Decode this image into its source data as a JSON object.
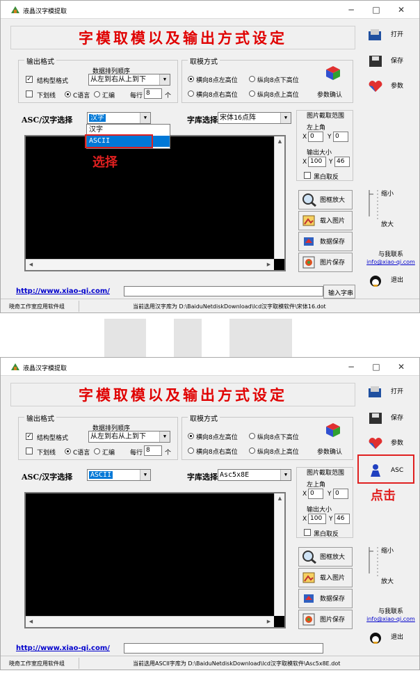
{
  "window": {
    "title": "液晶汉字模提取",
    "minimize": "−",
    "maximize": "□",
    "close": "✕"
  },
  "heading": "字模取模以及输出方式设定",
  "output_format": {
    "group_label": "输出格式",
    "struct_label": "结构型格式",
    "order_label": "数据排列顺序",
    "order_value": "从左到右从上到下",
    "underline_label": "下划线",
    "c_label": "C语言",
    "asm_label": "汇编",
    "per_row_label": "每行",
    "per_row_value": "8",
    "per_row_unit": "个"
  },
  "mode": {
    "group_label": "取模方式",
    "opt1": "横向8点左高位",
    "opt2": "纵向8点下高位",
    "opt3": "横向8点右高位",
    "opt4": "纵向8点上高位",
    "confirm": "参数确认"
  },
  "selectors": {
    "asc_label": "ASC/汉字选择",
    "lib_label": "字库选择"
  },
  "image_range": {
    "label": "图片截取范围",
    "topleft": "左上角",
    "x_label": "X",
    "y_label": "Y",
    "x_value": "0",
    "y_value": "0",
    "size_label": "输出大小",
    "w_value": "100",
    "h_value": "46",
    "invert": "黑白取反"
  },
  "buttons": {
    "zoom": "图框放大",
    "load": "载入图片",
    "save_data": "数据保存",
    "save_img": "图片保存",
    "input_string": "输入字串",
    "open": "打开",
    "save": "保存",
    "params": "参数",
    "exit": "退出",
    "asc": "ASC"
  },
  "slider": {
    "shrink": "缩小",
    "enlarge": "放大"
  },
  "contact": {
    "label": "与我联系",
    "email": "info@xiao-qi.com"
  },
  "url": "http://www.xiao-qi.com/",
  "status_left": "晓奇工作室应用软件组",
  "shot1": {
    "asc_value": "汉字",
    "lib_value": "宋体16点阵",
    "dropdown": [
      "汉字",
      "ASCII"
    ],
    "annotation": "选择",
    "status": "当前选用汉字库为 D:\\BaiduNetdiskDownload\\lcd汉字取模软件\\宋体16.dot"
  },
  "shot2": {
    "asc_value": "ASCII",
    "lib_value": "Asc5x8E",
    "annotation": "点击",
    "status": "当前选用ASCII字库为 D:\\BaiduNetdiskDownload\\lcd汉字取模软件\\Asc5x8E.dot"
  },
  "colors": {
    "title_red": "#e00000",
    "annotation_red": "#e02020",
    "selection_blue": "#0078d7",
    "link_blue": "#0000cc"
  }
}
